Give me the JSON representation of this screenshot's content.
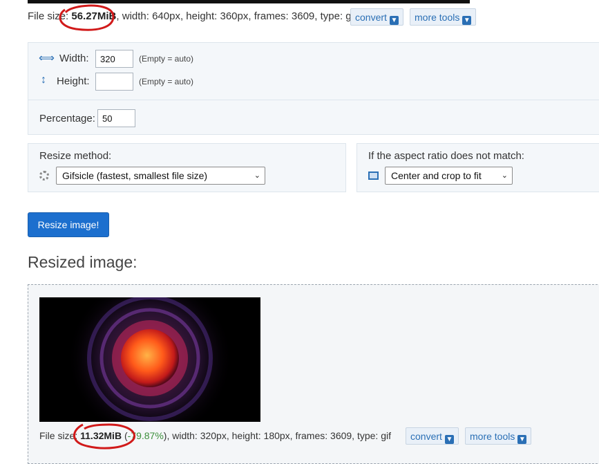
{
  "original": {
    "prefix": "File size: ",
    "size": "56.27MiB",
    "details": ", width: 640px, height: 360px, frames: 3609, type: gif",
    "convert_label": "convert",
    "more_tools_label": "more tools"
  },
  "dimensions": {
    "width_label": "Width:",
    "width_value": "320",
    "width_hint": "(Empty = auto)",
    "height_label": "Height:",
    "height_value": "",
    "height_hint": "(Empty = auto)",
    "percentage_label": "Percentage:",
    "percentage_value": "50"
  },
  "resize_method": {
    "label": "Resize method:",
    "selected": "Gifsicle (fastest, smallest file size)",
    "icon": "gear-icon"
  },
  "aspect": {
    "label": "If the aspect ratio does not match:",
    "selected": "Center and crop to fit",
    "icon": "crop-frame-icon"
  },
  "resize_button_label": "Resize image!",
  "resized": {
    "heading": "Resized image:",
    "prefix": "File size: ",
    "size": "11.32MiB",
    "change_open": " (",
    "change": "-79.87%",
    "change_close": ")",
    "details": ", width: 320px, height: 180px, frames: 3609, type: gif",
    "convert_label": "convert",
    "more_tools_label": "more tools"
  },
  "colors": {
    "accent": "#1c6fce",
    "annotation": "#d11a1a",
    "percent_green": "#3c8f3c"
  }
}
